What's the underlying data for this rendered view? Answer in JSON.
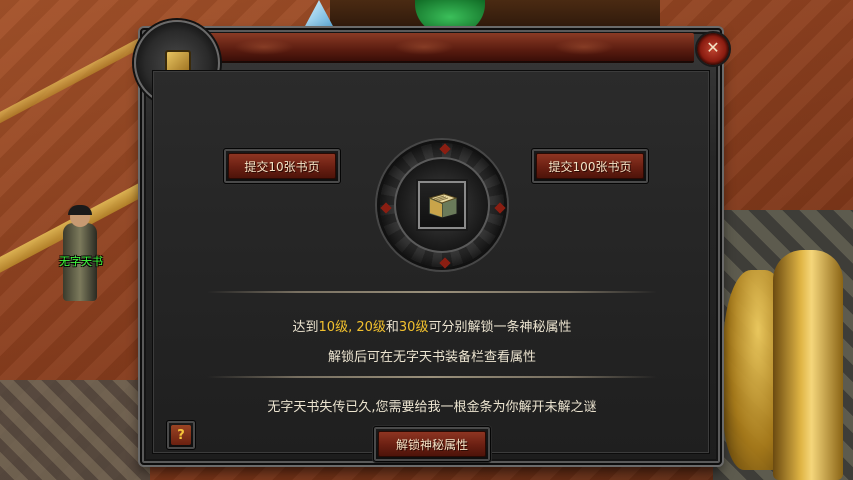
{
  "npc": {
    "name": "无字天书"
  },
  "dialog": {
    "close_icon": "close-icon",
    "emblem_icon": "book-icon",
    "submit_10_label": "提交10张书页",
    "submit_100_label": "提交100张书页",
    "item_icon": "book-icon",
    "info": {
      "line1_prefix": "达到",
      "level_10": "10级",
      "sep1": ", ",
      "level_20": "20级",
      "conj": "和",
      "level_30": "30级",
      "line1_suffix": "可分别解锁一条神秘属性",
      "line2": "解锁后可在无字天书装备栏查看属性"
    },
    "story": "无字天书失传已久,您需要给我一根金条为你解开未解之谜",
    "unlock_label": "解锁神秘属性",
    "help_label": "?"
  },
  "colors": {
    "highlight": "#f2c12e",
    "npc_name": "#3cff3c",
    "button_red": "#8e3522"
  }
}
